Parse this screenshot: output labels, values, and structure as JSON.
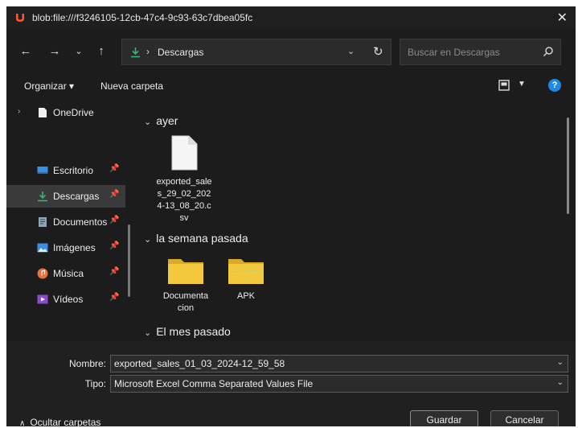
{
  "window": {
    "title": "blob:file:///f3246105-12cb-47c4-9c93-63c7dbea05fc",
    "close_symbol": "✕"
  },
  "address": {
    "separator": "›",
    "path": "Descargas",
    "search_placeholder": "Buscar en Descargas"
  },
  "toolbar": {
    "organize": "Organizar ▾",
    "new_folder": "Nueva carpeta",
    "help": "?"
  },
  "sidebar": {
    "items": [
      {
        "label": "OneDrive",
        "icon": "file-icon"
      },
      {
        "label": "Escritorio",
        "icon": "desktop-icon"
      },
      {
        "label": "Descargas",
        "icon": "download-icon"
      },
      {
        "label": "Documentos",
        "icon": "documents-icon"
      },
      {
        "label": "Imágenes",
        "icon": "pictures-icon"
      },
      {
        "label": "Música",
        "icon": "music-icon"
      },
      {
        "label": "Vídeos",
        "icon": "videos-icon"
      }
    ]
  },
  "groups": {
    "yesterday": "ayer",
    "last_week": "la semana pasada",
    "last_month": "El mes pasado"
  },
  "files": {
    "csv_name": "exported_sales_29_02_2024-13_08_20.csv",
    "folder1_name": "Documentacion",
    "folder2_name": "APK"
  },
  "form": {
    "name_label": "Nombre:",
    "name_value": "exported_sales_01_03_2024-12_59_58",
    "type_label": "Tipo:",
    "type_value": "Microsoft Excel Comma Separated Values File"
  },
  "footer": {
    "hide_folders": "Ocultar carpetas",
    "save": "Guardar",
    "cancel": "Cancelar"
  },
  "colors": {
    "accent": "#1e88e5",
    "folder": "#f3c83c",
    "download_green": "#3cb371"
  }
}
